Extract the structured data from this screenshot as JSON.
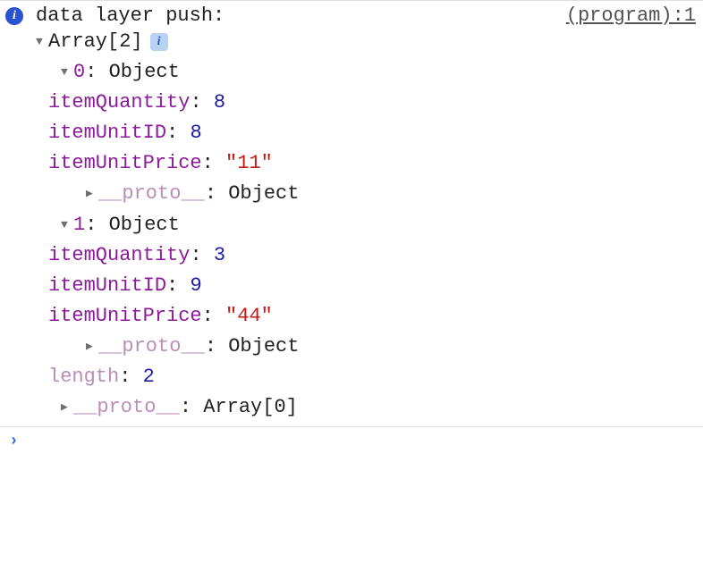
{
  "header": {
    "log_label": "data layer push:",
    "source_text": "(program):1"
  },
  "tree": {
    "root_label": "Array",
    "root_count": "[2]",
    "entries": [
      {
        "index": "0",
        "type": "Object",
        "props": [
          {
            "key": "itemQuantity",
            "value": "8",
            "kind": "number"
          },
          {
            "key": "itemUnitID",
            "value": "8",
            "kind": "number"
          },
          {
            "key": "itemUnitPrice",
            "value": "\"11\"",
            "kind": "string"
          }
        ],
        "proto_label": "__proto__",
        "proto_value": "Object"
      },
      {
        "index": "1",
        "type": "Object",
        "props": [
          {
            "key": "itemQuantity",
            "value": "3",
            "kind": "number"
          },
          {
            "key": "itemUnitID",
            "value": "9",
            "kind": "number"
          },
          {
            "key": "itemUnitPrice",
            "value": "\"44\"",
            "kind": "string"
          }
        ],
        "proto_label": "__proto__",
        "proto_value": "Object"
      }
    ],
    "length_key": "length",
    "length_value": "2",
    "arr_proto_label": "__proto__",
    "arr_proto_value": "Array[0]"
  },
  "prompt": "›"
}
